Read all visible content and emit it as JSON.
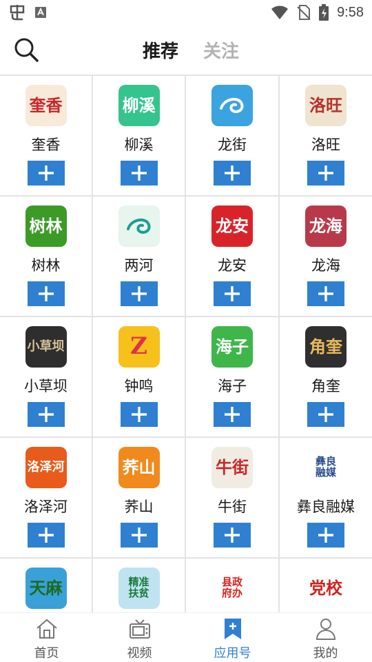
{
  "status_bar": {
    "time": "9:58"
  },
  "header": {
    "tabs": [
      {
        "label": "推荐",
        "active": true
      },
      {
        "label": "关注",
        "active": false
      }
    ]
  },
  "apps": [
    {
      "name": "奎香",
      "icon_text": "奎香",
      "icon_bg": "#f8ead8",
      "icon_fg": "#c8262b"
    },
    {
      "name": "柳溪",
      "icon_text": "柳溪",
      "icon_bg": "#36c48e",
      "icon_fg": "#ffffff"
    },
    {
      "name": "龙街",
      "icon_text": "",
      "icon_bg": "#3aa3e0",
      "icon_fg": "#ffffff"
    },
    {
      "name": "洛旺",
      "icon_text": "洛旺",
      "icon_bg": "#efe4cf",
      "icon_fg": "#b5322d"
    },
    {
      "name": "树林",
      "icon_text": "树林",
      "icon_bg": "#3b9b26",
      "icon_fg": "#ffffff"
    },
    {
      "name": "两河",
      "icon_text": "",
      "icon_bg": "#e6f5ee",
      "icon_fg": "#1f9c92"
    },
    {
      "name": "龙安",
      "icon_text": "龙安",
      "icon_bg": "#d9232a",
      "icon_fg": "#ffffff"
    },
    {
      "name": "龙海",
      "icon_text": "龙海",
      "icon_bg": "#b83a4a",
      "icon_fg": "#ffffff"
    },
    {
      "name": "小草坝",
      "icon_text": "小草坝",
      "icon_bg": "#2e2e2e",
      "icon_fg": "#d8c39a"
    },
    {
      "name": "钟鸣",
      "icon_text": "Z",
      "icon_bg": "#f5c11a",
      "icon_fg": "#e0314b"
    },
    {
      "name": "海子",
      "icon_text": "海子",
      "icon_bg": "#3eb64a",
      "icon_fg": "#ffffff"
    },
    {
      "name": "角奎",
      "icon_text": "角奎",
      "icon_bg": "#2f2f2f",
      "icon_fg": "#e8b95b"
    },
    {
      "name": "洛泽河",
      "icon_text": "洛泽河",
      "icon_bg": "#e85b1a",
      "icon_fg": "#ffffff"
    },
    {
      "name": "荞山",
      "icon_text": "荞山",
      "icon_bg": "#f08a1c",
      "icon_fg": "#ffffff"
    },
    {
      "name": "牛街",
      "icon_text": "牛街",
      "icon_bg": "#f1ece2",
      "icon_fg": "#c8262b"
    },
    {
      "name": "彝良融媒",
      "icon_text": "彝良融媒",
      "icon_bg": "#ffffff",
      "icon_fg": "#2a4f8f"
    },
    {
      "name": "天麻",
      "icon_text": "天麻",
      "icon_bg": "#3aa0d8",
      "icon_fg": "#1b6b1f"
    },
    {
      "name": "精准扶贫",
      "icon_text": "精准扶贫",
      "icon_bg": "#bfe3f1",
      "icon_fg": "#1b7a3a"
    },
    {
      "name": "县政府办",
      "icon_text": "县政府办",
      "icon_bg": "#ffffff",
      "icon_fg": "#d2231f"
    },
    {
      "name": "党校",
      "icon_text": "党校",
      "icon_bg": "#ffffff",
      "icon_fg": "#d2231f"
    }
  ],
  "add_label": "+",
  "bottom_nav": [
    {
      "label": "首页",
      "icon": "home-icon",
      "active": false
    },
    {
      "label": "视频",
      "icon": "tv-icon",
      "active": false
    },
    {
      "label": "应用号",
      "icon": "bookmark-icon",
      "active": true
    },
    {
      "label": "我的",
      "icon": "user-icon",
      "active": false
    }
  ],
  "colors": {
    "accent": "#2f80d1",
    "divider": "#e3e3e3"
  }
}
